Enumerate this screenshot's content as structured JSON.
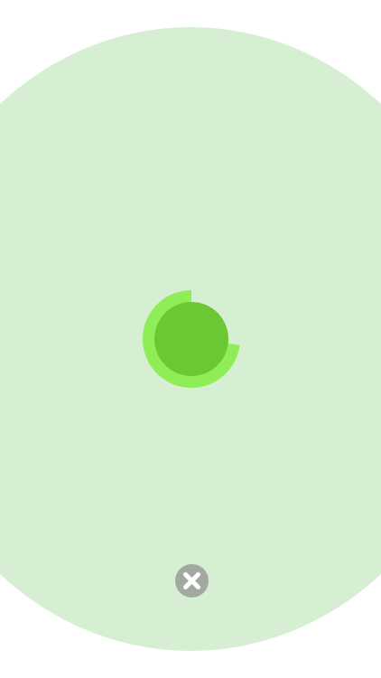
{
  "colors": {
    "background": "#ffffff",
    "halo": "#d6efd3",
    "ring_progress": "#8fee58",
    "center_dot": "#6bc832",
    "close_button_bg": "#a3a9a0",
    "close_icon": "#ffffff"
  },
  "progress": {
    "fraction": 0.27
  },
  "icons": {
    "close": "close-icon"
  }
}
